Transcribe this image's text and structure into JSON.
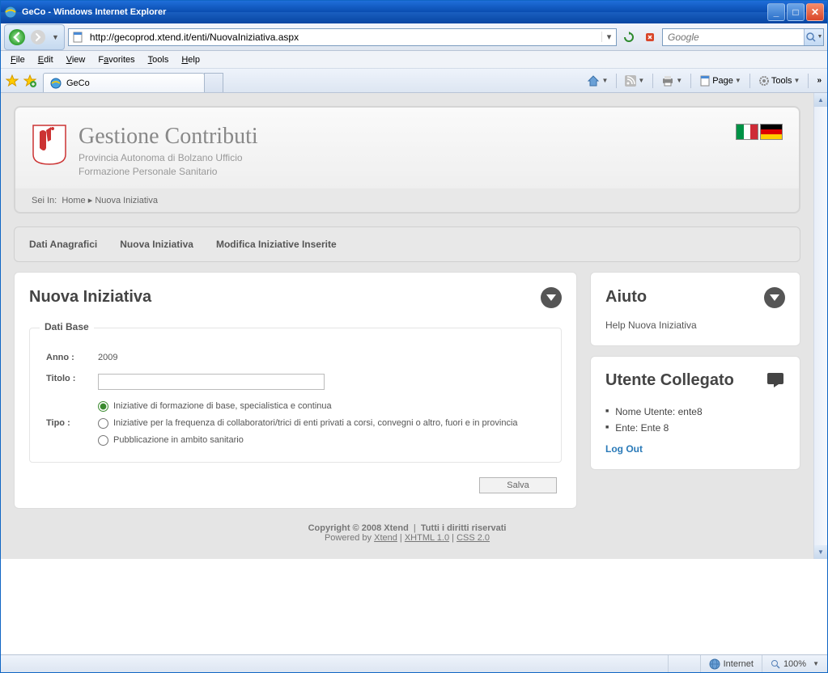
{
  "window": {
    "title": "GeCo - Windows Internet Explorer",
    "url": "http://gecoprod.xtend.it/enti/NuovaIniziativa.aspx",
    "search_placeholder": "Google"
  },
  "menubar": {
    "file": "File",
    "edit": "Edit",
    "view": "View",
    "favorites": "Favorites",
    "tools": "Tools",
    "help": "Help"
  },
  "tab": {
    "title": "GeCo"
  },
  "cmdbar": {
    "page": "Page",
    "tools": "Tools"
  },
  "header": {
    "title": "Gestione Contributi",
    "subtitle1": "Provincia Autonoma di Bolzano Ufficio",
    "subtitle2": "Formazione Personale Sanitario"
  },
  "breadcrumb": {
    "prefix": "Sei In:",
    "home": "Home",
    "sep": "▸",
    "current": "Nuova Iniziativa"
  },
  "tabs": {
    "t1": "Dati Anagrafici",
    "t2": "Nuova Iniziativa",
    "t3": "Modifica Iniziative Inserite"
  },
  "panel": {
    "title": "Nuova Iniziativa",
    "fieldset": "Dati Base",
    "anno_label": "Anno :",
    "anno_value": "2009",
    "titolo_label": "Titolo :",
    "tipo_label": "Tipo :",
    "radio1": "Iniziative di formazione di base, specialistica e continua",
    "radio2": "Iniziative per la frequenza di collaboratori/trici di enti privati a corsi, convegni o altro, fuori e in provincia",
    "radio3": "Pubblicazione in ambito sanitario",
    "save": "Salva"
  },
  "help": {
    "title": "Aiuto",
    "text": "Help Nuova Iniziativa"
  },
  "user": {
    "title": "Utente Collegato",
    "name_line": "Nome Utente: ente8",
    "ente_line": "Ente: Ente 8",
    "logout": "Log Out"
  },
  "footer": {
    "copy": "Copyright © 2008 Xtend",
    "rights": "Tutti i diritti riservati",
    "powered": "Powered by",
    "l1": "Xtend",
    "l2": "XHTML 1.0",
    "l3": "CSS 2.0"
  },
  "statusbar": {
    "zone": "Internet",
    "zoom": "100%"
  }
}
